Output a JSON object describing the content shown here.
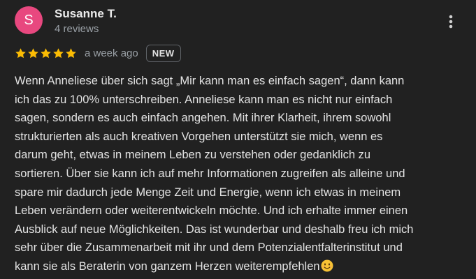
{
  "reviewer": {
    "initial": "S",
    "name": "Susanne T.",
    "meta": "4 reviews",
    "avatar_color": "#e8487f"
  },
  "rating": {
    "stars": 5,
    "max_stars": 5,
    "star_color": "#fbbc04",
    "date": "a week ago",
    "badge": "NEW"
  },
  "menu": {
    "icon": "more-vert-icon"
  },
  "review": {
    "text": "Wenn Anneliese über sich sagt „Mir kann man es einfach sagen“, dann kann\nich das zu 100% unterschreiben. Anneliese kann man es nicht nur einfach\nsagen, sondern es auch einfach angehen. Mit ihrer Klarheit, ihrem sowohl\nstrukturierten als auch kreativen Vorgehen unterstützt sie mich, wenn es\ndarum geht, etwas in meinem Leben zu verstehen oder gedanklich zu\nsortieren. Über sie kann ich auf mehr Informationen zugreifen als alleine und\nspare mir dadurch jede Menge Zeit und Energie, wenn ich etwas in meinem\nLeben verändern oder weiterentwickeln möchte. Und ich erhalte immer einen\nAusblick auf neue Möglichkeiten. Das ist wunderbar und deshalb freu ich mich\nsehr über die Zusammenarbeit mit ihr und dem Potenzialentfalterinstitut und\nkann sie als Beraterin von ganzem Herzen weiterempfehlen",
    "emoji": "smiling-face-emoji"
  }
}
